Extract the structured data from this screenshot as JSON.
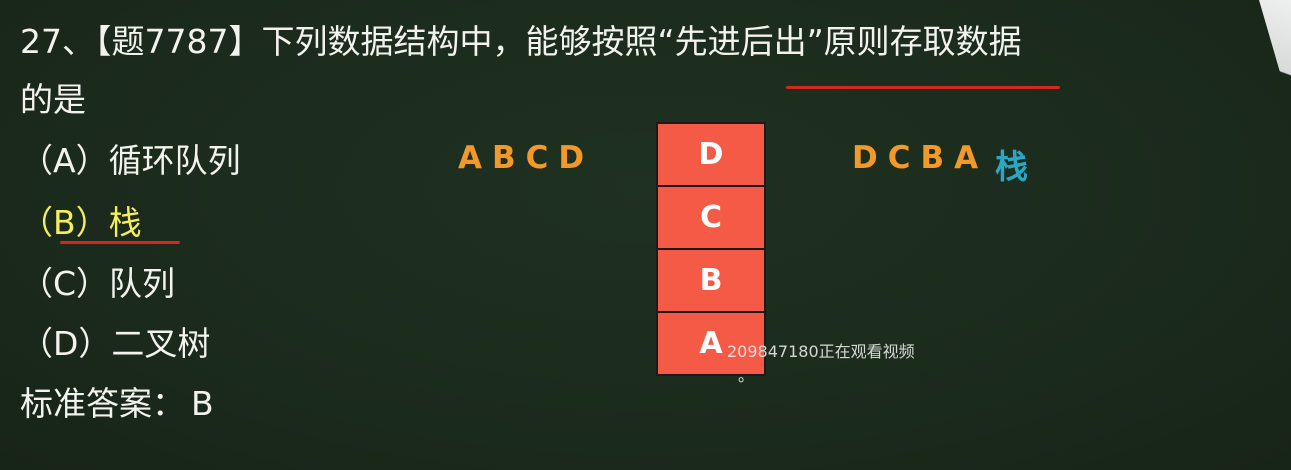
{
  "question": {
    "line1": "27、【题7787】下列数据结构中，能够按照“先进后出”原则存取数据",
    "line2": "的是"
  },
  "options": [
    {
      "label": "（A）循环队列"
    },
    {
      "label": "（B）栈"
    },
    {
      "label": "（C）队列"
    },
    {
      "label": "（D）二叉树"
    }
  ],
  "answer": {
    "label": "标准答案：",
    "value": "B"
  },
  "diagram": {
    "push_order": "ABCD",
    "pop_order": "DCBA",
    "stack_label": "栈",
    "stack_cells": [
      "D",
      "C",
      "B",
      "A"
    ]
  },
  "overlay": {
    "watermark": "209847180正在观看视频",
    "dot": "。"
  },
  "colors": {
    "board": "#1c2c1e",
    "text": "#f2f2ee",
    "highlight": "#f4ee5a",
    "underline": "#d8261d",
    "handwriting": "#f19a2a",
    "stack_word": "#2aa7c2",
    "stack_fill": "#f55a47"
  }
}
